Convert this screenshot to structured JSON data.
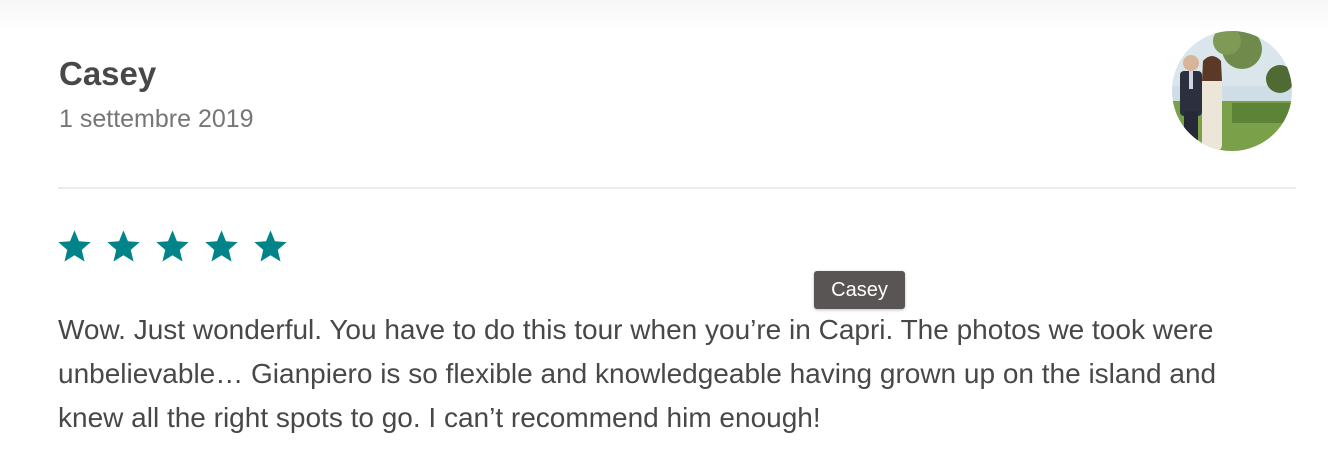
{
  "review": {
    "reviewer_name": "Casey",
    "date": "1 settembre 2019",
    "rating": 5,
    "text": "Wow. Just wonderful. You have to do this tour when you’re in Capri. The photos we took were unbelievable… Gianpiero is so flexible and knowledgeable having grown up on the island and knew all the right spots to go. I can’t recommend him enough!"
  },
  "tooltip": {
    "text": "Casey"
  },
  "colors": {
    "star": "#008489",
    "text": "#484848",
    "muted": "#767676",
    "divider": "#ebebeb",
    "tooltip_bg": "#595554"
  },
  "icons": {
    "rating": "star-icon",
    "avatar": "reviewer-photo"
  }
}
